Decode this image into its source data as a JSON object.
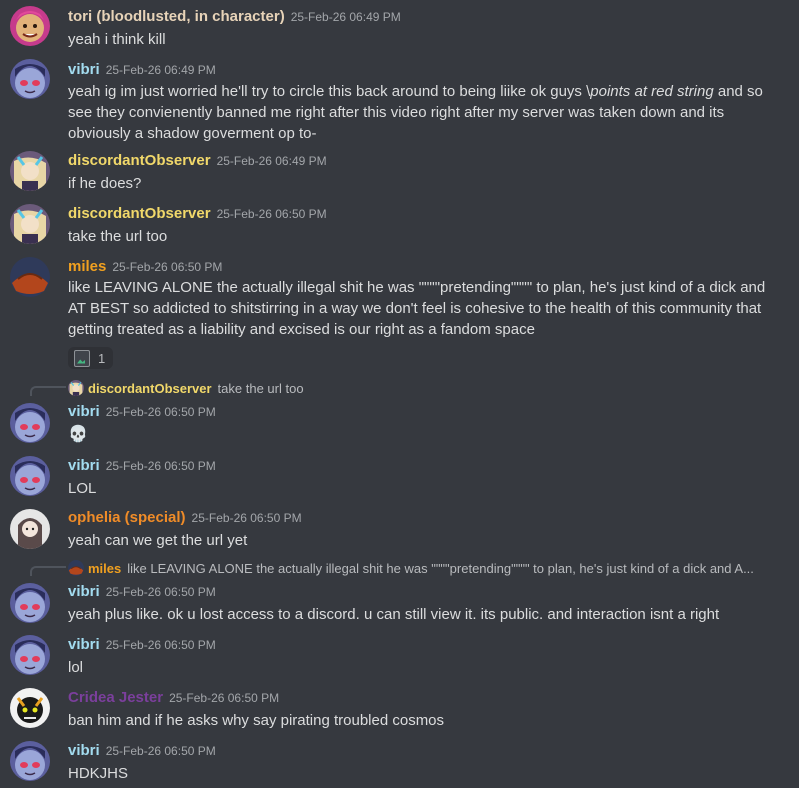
{
  "colors": {
    "background": "#36393f",
    "tori": "#e7d3b8",
    "vibri": "#a3dcf0",
    "discordantObserver": "#f1d86a",
    "miles": "#f0a020",
    "ophelia": "#f08c28",
    "cridea": "#7b3f9c"
  },
  "messages": [
    {
      "author": "tori (bloodlusted, in character)",
      "time": "25-Feb-26 06:49 PM",
      "text": "yeah i think kill",
      "avatar": "tori-avatar"
    },
    {
      "author": "vibri",
      "time": "25-Feb-26 06:49 PM",
      "text_a": "yeah ig im just worried he'll try to circle this back around to being liike ok guys \\",
      "text_em": "points at red string",
      "text_b": " and so see they convienently banned me right after this video right after my server was taken down and its obviously a shadow goverment op to-",
      "avatar": "vibri-avatar"
    },
    {
      "author": "discordantObserver",
      "time": "25-Feb-26 06:49 PM",
      "text": "if he does?",
      "avatar": "observer-avatar"
    },
    {
      "author": "discordantObserver",
      "time": "25-Feb-26 06:50 PM",
      "text": "take the url too",
      "avatar": "observer-avatar"
    },
    {
      "author": "miles",
      "time": "25-Feb-26 06:50 PM",
      "text": "like LEAVING ALONE the actually illegal shit he was \"\"\"\"pretending\"\"\"\" to plan, he's just kind of a dick and AT BEST so addicted to shitstirring in a way we don't feel is cohesive to the health of this community that getting treated as a liability and excised is our right as a fandom space",
      "avatar": "miles-avatar",
      "reaction_count": "1"
    },
    {
      "reply_author": "discordantObserver",
      "reply_text": "take the url too",
      "author": "vibri",
      "time": "25-Feb-26 06:50 PM",
      "text": "💀",
      "avatar": "vibri-avatar"
    },
    {
      "author": "vibri",
      "time": "25-Feb-26 06:50 PM",
      "text": "LOL",
      "avatar": "vibri-avatar"
    },
    {
      "author": "ophelia (special)",
      "time": "25-Feb-26 06:50 PM",
      "text": "yeah can we get the url yet",
      "avatar": "ophelia-avatar"
    },
    {
      "reply_author": "miles",
      "reply_text": "like LEAVING ALONE the actually illegal shit he was \"\"\"\"pretending\"\"\"\" to plan, he's just kind of a dick and A...",
      "author": "vibri",
      "time": "25-Feb-26 06:50 PM",
      "text": "yeah plus like. ok u lost access to a discord. u can still view it. its public. and interaction isnt a right",
      "avatar": "vibri-avatar"
    },
    {
      "author": "vibri",
      "time": "25-Feb-26 06:50 PM",
      "text": "lol",
      "avatar": "vibri-avatar"
    },
    {
      "author": "Cridea Jester",
      "time": "25-Feb-26 06:50 PM",
      "text": "ban him and if he asks why say pirating troubled cosmos",
      "avatar": "cridea-avatar"
    },
    {
      "author": "vibri",
      "time": "25-Feb-26 06:50 PM",
      "text": "HDKJHS",
      "avatar": "vibri-avatar"
    }
  ]
}
